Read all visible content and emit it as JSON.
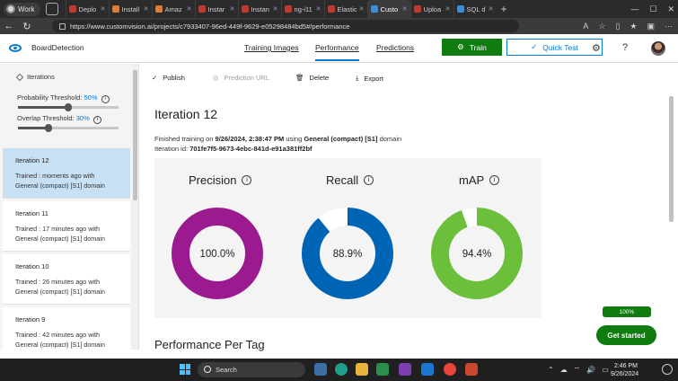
{
  "browser": {
    "profile": "Work",
    "tabs": [
      {
        "label": "Deplo",
        "color": "#c0392b"
      },
      {
        "label": "Install",
        "color": "#e07b39"
      },
      {
        "label": "Amaz",
        "color": "#e07b39"
      },
      {
        "label": "Instar",
        "color": "#c0392b"
      },
      {
        "label": "Instan",
        "color": "#c0392b"
      },
      {
        "label": "ng-i11",
        "color": "#c0392b"
      },
      {
        "label": "Elastic",
        "color": "#c0392b"
      },
      {
        "label": "Custo",
        "color": "#3b8fd6"
      },
      {
        "label": "Uploa",
        "color": "#c0392b"
      },
      {
        "label": "SQL d",
        "color": "#3b8fd6"
      }
    ],
    "url": "https://www.customvision.ai/projects/c7933407-96ed-449f-9629-e05298484bd5#/performance"
  },
  "header": {
    "project_name": "BoardDetection",
    "nav": {
      "training_images": "Training Images",
      "performance": "Performance",
      "predictions": "Predictions"
    },
    "train_label": "Train",
    "quick_test_label": "Quick Test",
    "help": "?"
  },
  "sidebar": {
    "title": "Iterations",
    "probability_label": "Probability Threshold:",
    "probability_value": "50%",
    "probability_level": 0.5,
    "overlap_label": "Overlap Threshold:",
    "overlap_value": "30%",
    "overlap_level": 0.3,
    "iterations": [
      {
        "name": "Iteration 12",
        "line1": "Trained : moments ago with",
        "line2": "General (compact) [S1] domain",
        "selected": true
      },
      {
        "name": "Iteration 11",
        "line1": "Trained : 17 minutes ago with",
        "line2": "General (compact) [S1] domain",
        "selected": false
      },
      {
        "name": "Iteration 10",
        "line1": "Trained : 26 minutes ago with",
        "line2": "General (compact) [S1] domain",
        "selected": false
      },
      {
        "name": "Iteration 9",
        "line1": "Trained : 42 minutes ago with",
        "line2": "General (compact) [S1] domain",
        "selected": false
      }
    ]
  },
  "toolbar": {
    "publish": "Publish",
    "prediction_url": "Prediction URL",
    "delete": "Delete",
    "export": "Export"
  },
  "main": {
    "title": "Iteration 12",
    "finished_prefix": "Finished training on ",
    "finished_date": "9/26/2024, 2:38:47 PM",
    "finished_mid": " using ",
    "finished_domain": "General (compact) [S1]",
    "finished_suffix": " domain",
    "iteration_id_label": "Iteration id: ",
    "iteration_id": "701fe7f5-9673-4ebc-841d-e91a381ff2bf",
    "metrics": [
      {
        "name": "Precision",
        "value": 100.0,
        "display": "100.0%",
        "color": "#9b1a8f"
      },
      {
        "name": "Recall",
        "value": 88.9,
        "display": "88.9%",
        "color": "#0064b4"
      },
      {
        "name": "mAP",
        "value": 94.4,
        "display": "94.4%",
        "color": "#6bbf3b"
      }
    ],
    "section_title": "Performance Per Tag"
  },
  "overlay": {
    "progress": "100%",
    "get_started": "Get started"
  },
  "taskbar": {
    "search": "Search",
    "time": "2:46 PM",
    "date": "9/26/2024"
  }
}
